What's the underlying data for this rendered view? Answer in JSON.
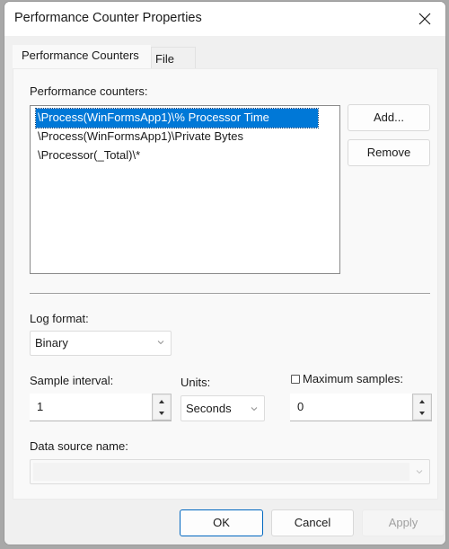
{
  "window": {
    "title": "Performance Counter Properties"
  },
  "tabs": [
    {
      "label": "Performance Counters",
      "active": true
    },
    {
      "label": "File",
      "active": false
    }
  ],
  "counters": {
    "label": "Performance counters:",
    "items": [
      {
        "text": "\\Process(WinFormsApp1)\\% Processor Time",
        "selected": true
      },
      {
        "text": "\\Process(WinFormsApp1)\\Private Bytes",
        "selected": false
      },
      {
        "text": "\\Processor(_Total)\\*",
        "selected": false
      }
    ],
    "add_label": "Add...",
    "remove_label": "Remove"
  },
  "log_format": {
    "label": "Log format:",
    "value": "Binary"
  },
  "sample_interval": {
    "label": "Sample interval:",
    "value": "1"
  },
  "units": {
    "label": "Units:",
    "value": "Seconds"
  },
  "max_samples": {
    "label": "Maximum samples:",
    "checked": false,
    "value": "0"
  },
  "data_source": {
    "label": "Data source name:",
    "value": "",
    "disabled": true
  },
  "footer": {
    "ok_label": "OK",
    "cancel_label": "Cancel",
    "apply_label": "Apply",
    "apply_disabled": true
  },
  "colors": {
    "selection": "#0078d7",
    "default_button_border": "#0067c0",
    "disabled_text": "#a0a0a0"
  }
}
